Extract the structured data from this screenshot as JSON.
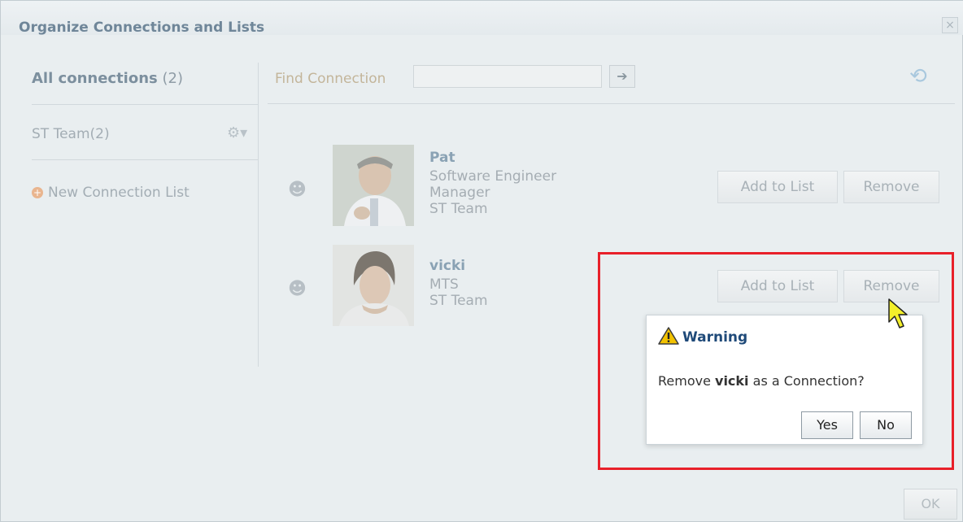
{
  "dialog": {
    "title": "Organize Connections and Lists",
    "close_icon": "×"
  },
  "sidebar": {
    "all_connections_label": "All connections",
    "all_connections_count": "(2)",
    "lists": [
      {
        "label": "ST Team",
        "count": "(2)",
        "gear_icon": "⚙▾"
      }
    ],
    "new_list_label": "New Connection List",
    "new_list_icon": "+"
  },
  "search": {
    "label": "Find Connection",
    "value": "",
    "go_icon": "➔",
    "refresh_icon": "⟲"
  },
  "connections": [
    {
      "name": "Pat",
      "title": "Software Engineer",
      "role": "Manager",
      "list": "ST Team",
      "add_label": "Add to List",
      "remove_label": "Remove"
    },
    {
      "name": "vicki",
      "title": "MTS",
      "list": "ST Team",
      "add_label": "Add to List",
      "remove_label": "Remove"
    }
  ],
  "warning": {
    "title": "Warning",
    "message_prefix": "Remove ",
    "message_name": "vicki",
    "message_suffix": " as a Connection?",
    "yes_label": "Yes",
    "no_label": "No"
  },
  "footer": {
    "ok_label": "OK"
  },
  "colors": {
    "highlight": "#e8202a",
    "warning_title": "#1f4a79"
  }
}
